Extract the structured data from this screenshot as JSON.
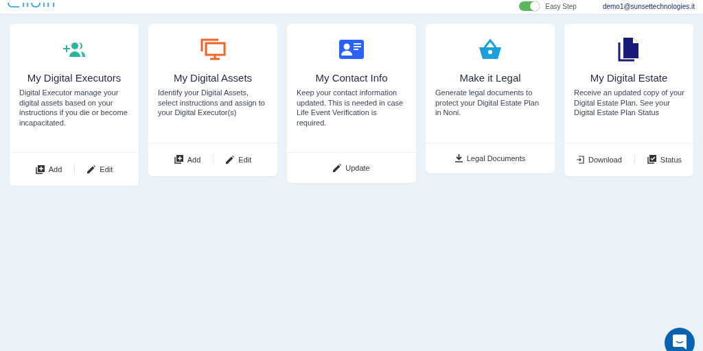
{
  "header": {
    "toggle": {
      "label": "Easy Step",
      "on": true
    },
    "user_email": "demo1@sunsettechnologies.it"
  },
  "cards": [
    {
      "kind": "people-add",
      "title": "My Digital Executors",
      "description": "Digital Executor manage your digital assets based on your instructions if you die or become incapacitated.",
      "actions": [
        {
          "kind": "add",
          "label": "Add"
        },
        {
          "kind": "edit",
          "label": "Edit"
        }
      ]
    },
    {
      "kind": "monitors",
      "title": "My Digital Assets",
      "description": "Identify your Digital Assets, select instructions and assign to your Digital Executor(s)",
      "actions": [
        {
          "kind": "add",
          "label": "Add"
        },
        {
          "kind": "edit",
          "label": "Edit"
        }
      ]
    },
    {
      "kind": "contact-card",
      "title": "My Contact Info",
      "description": "Keep your contact information updated. This is needed in case Life Event Verification is required.",
      "actions": [
        {
          "kind": "edit",
          "label": "Update"
        }
      ]
    },
    {
      "kind": "basket",
      "title": "Make it Legal",
      "description": "Generate legal documents to protect your Digital Estate Plan in Noni.",
      "actions": [
        {
          "kind": "download",
          "label": "Legal Documents"
        }
      ]
    },
    {
      "kind": "documents",
      "title": "My Digital Estate",
      "description": "Receive an updated copy of your Digital Estate Plan. See your Digital Estate Plan Status",
      "actions": [
        {
          "kind": "export",
          "label": "Download"
        },
        {
          "kind": "status",
          "label": "Status"
        }
      ]
    }
  ]
}
